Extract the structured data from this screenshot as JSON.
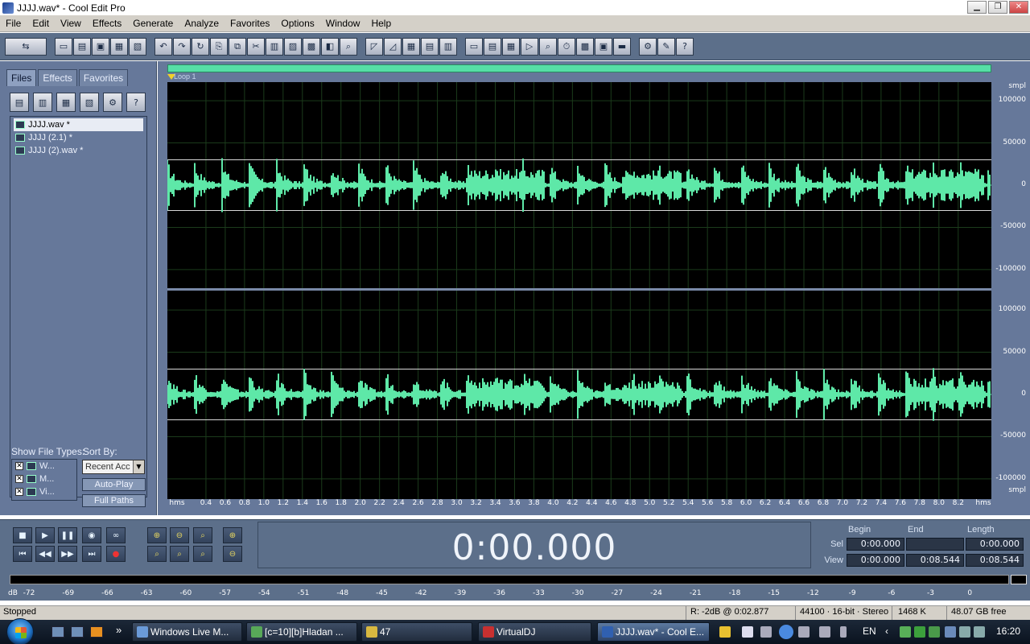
{
  "window": {
    "title": "JJJJ.wav* - Cool Edit Pro",
    "minimize_icon": "▁",
    "maximize_icon": "❐",
    "close_icon": "✕"
  },
  "menu": [
    "File",
    "Edit",
    "View",
    "Effects",
    "Generate",
    "Analyze",
    "Favorites",
    "Options",
    "Window",
    "Help"
  ],
  "left_panel": {
    "tabs": [
      "Files",
      "Effects",
      "Favorites"
    ],
    "active_tab": "Files",
    "files": [
      "JJJJ.wav *",
      "JJJJ (2.1) *",
      "JJJJ (2).wav *"
    ],
    "selected_file": "JJJJ.wav *",
    "show_file_types_label": "Show File Types:",
    "sort_by_label": "Sort By:",
    "file_types": [
      {
        "label": "W...",
        "checked": true
      },
      {
        "label": "M...",
        "checked": true
      },
      {
        "label": "Vi...",
        "checked": true
      }
    ],
    "sort_value": "Recent Acc",
    "auto_play_label": "Auto-Play",
    "full_paths_label": "Full Paths"
  },
  "waveform": {
    "loop_label": "Loop 1",
    "y_unit": "smpl",
    "y_ticks": [
      "100000",
      "50000",
      "0",
      "-50000",
      "-100000"
    ],
    "time_unit": "hms",
    "time_ticks": [
      "0.4",
      "0.6",
      "0.8",
      "1.0",
      "1.2",
      "1.4",
      "1.6",
      "1.8",
      "2.0",
      "2.2",
      "2.4",
      "2.6",
      "2.8",
      "3.0",
      "3.2",
      "3.4",
      "3.6",
      "3.8",
      "4.0",
      "4.2",
      "4.4",
      "4.6",
      "4.8",
      "5.0",
      "5.2",
      "5.4",
      "5.6",
      "5.8",
      "6.0",
      "6.2",
      "6.4",
      "6.6",
      "6.8",
      "7.0",
      "7.2",
      "7.4",
      "7.6",
      "7.8",
      "8.0",
      "8.2"
    ],
    "duration_seconds": 8.544,
    "wave_color": "#5ee8a8",
    "channels": 2
  },
  "transport": {
    "time": "0:00.000",
    "selview": {
      "headers": {
        "begin": "Begin",
        "end": "End",
        "length": "Length"
      },
      "sel": {
        "label": "Sel",
        "begin": "0:00.000",
        "end": "",
        "length": "0:00.000"
      },
      "view": {
        "label": "View",
        "begin": "0:00.000",
        "end": "0:08.544",
        "length": "0:08.544"
      }
    }
  },
  "meter": {
    "unit": "dB",
    "ticks": [
      "-72",
      "-69",
      "-66",
      "-63",
      "-60",
      "-57",
      "-54",
      "-51",
      "-48",
      "-45",
      "-42",
      "-39",
      "-36",
      "-33",
      "-30",
      "-27",
      "-24",
      "-21",
      "-18",
      "-15",
      "-12",
      "-9",
      "-6",
      "-3",
      "0"
    ]
  },
  "status": {
    "state": "Stopped",
    "cursor": "R: -2dB @   0:02.877",
    "format": "44100 · 16-bit · Stereo",
    "size": "1468 K",
    "free": "48.07 GB free"
  },
  "taskbar": {
    "items": [
      {
        "label": "Windows Live M...",
        "active": false
      },
      {
        "label": "[c=10][b]Hladan ...",
        "active": false
      },
      {
        "label": "47",
        "active": false
      },
      {
        "label": "VirtualDJ",
        "active": false
      },
      {
        "label": "JJJJ.wav* - Cool E...",
        "active": true
      }
    ],
    "overflow": "»",
    "language": "EN",
    "clock": "16:20"
  }
}
